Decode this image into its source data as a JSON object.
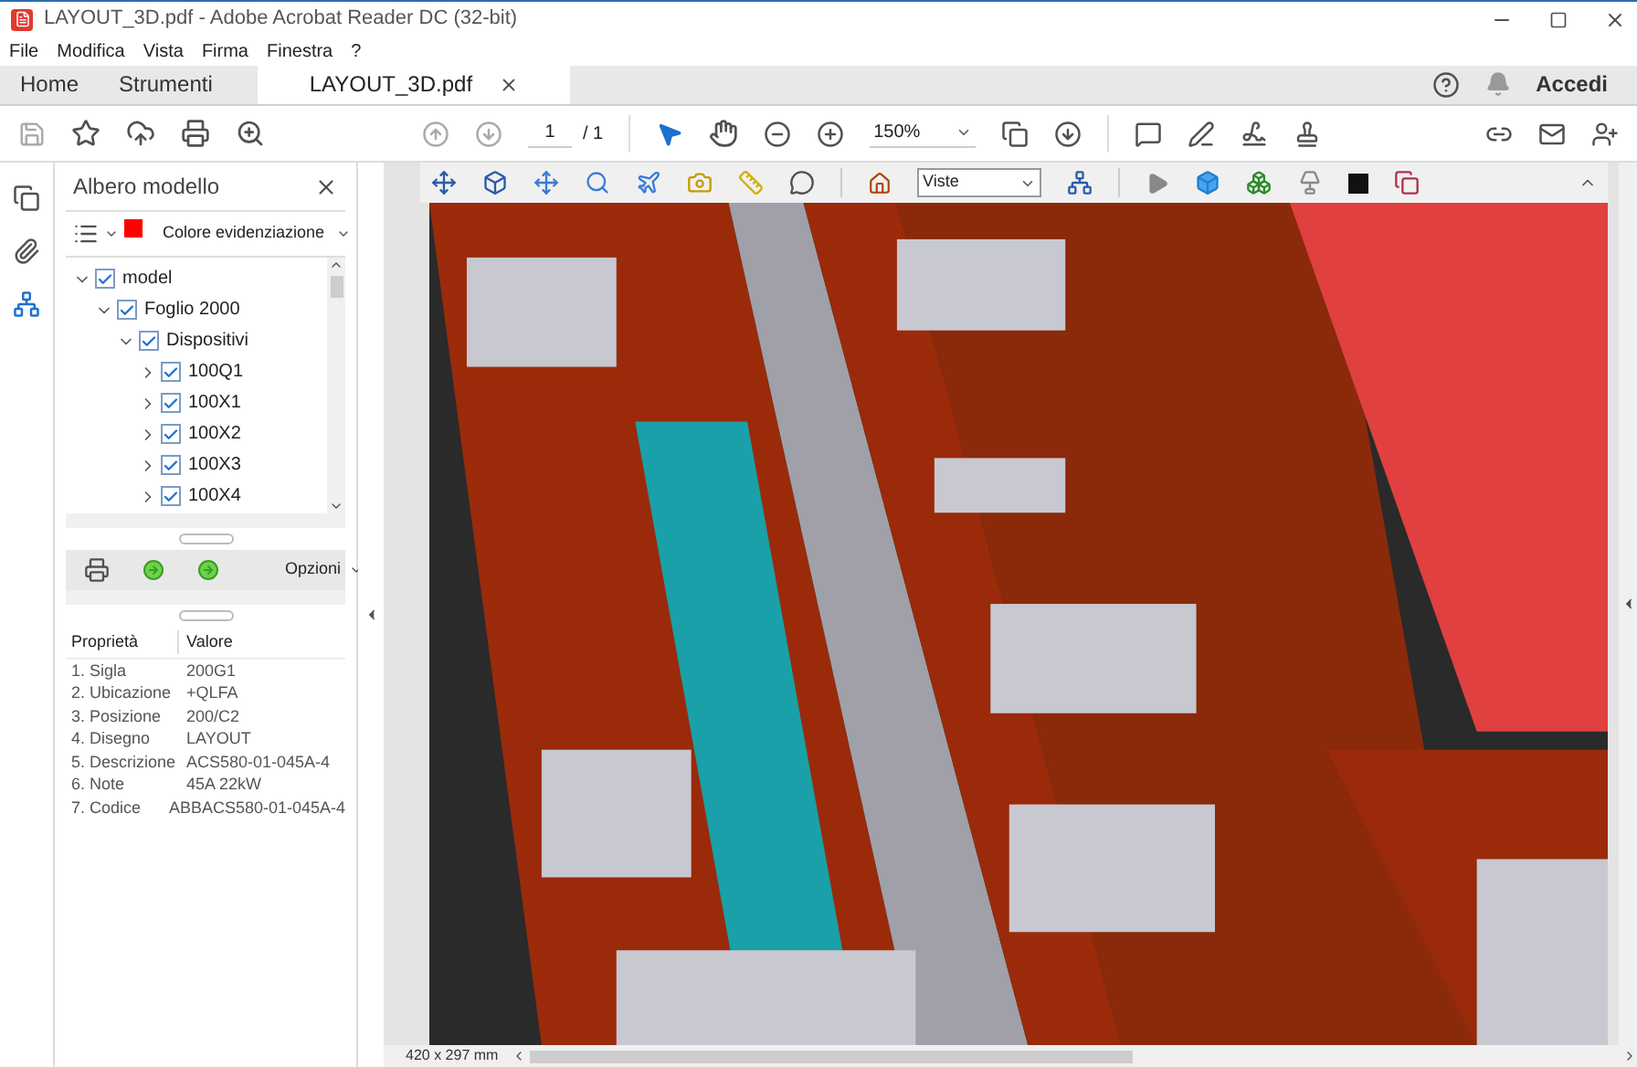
{
  "window": {
    "title": "LAYOUT_3D.pdf - Adobe Acrobat Reader DC (32-bit)"
  },
  "menu": [
    "File",
    "Modifica",
    "Vista",
    "Firma",
    "Finestra",
    "?"
  ],
  "tabs": [
    {
      "label": "Home",
      "selected": false,
      "kind": "nav"
    },
    {
      "label": "Strumenti",
      "selected": false,
      "kind": "nav"
    },
    {
      "label": "LAYOUT_3D.pdf",
      "selected": true,
      "kind": "document"
    }
  ],
  "sign_in": "Accedi",
  "toolbar": {
    "page": "1",
    "page_total": "/ 1",
    "zoom": "150%"
  },
  "panel": {
    "title": "Albero modello",
    "highlight_label": "Colore evidenziazione",
    "color": "#ff0000",
    "tree": [
      {
        "label": "model",
        "expanded": true,
        "checked": true,
        "children": [
          {
            "label": "Foglio 2000",
            "expanded": true,
            "checked": true,
            "children": [
              {
                "label": "Dispositivi",
                "expanded": true,
                "checked": true,
                "children": [
                  {
                    "label": "100Q1",
                    "expanded": false,
                    "checked": true
                  },
                  {
                    "label": "100X1",
                    "expanded": false,
                    "checked": true
                  },
                  {
                    "label": "100X2",
                    "expanded": false,
                    "checked": true
                  },
                  {
                    "label": "100X3",
                    "expanded": false,
                    "checked": true
                  },
                  {
                    "label": "100X4",
                    "expanded": false,
                    "checked": true
                  }
                ]
              }
            ]
          }
        ]
      }
    ],
    "options": "Opzioni",
    "properties": {
      "columns": [
        "Proprietà",
        "Valore"
      ],
      "rows": [
        [
          "1. Sigla",
          "200G1"
        ],
        [
          "2. Ubicazione",
          "+QLFA"
        ],
        [
          "3. Posizione",
          "200/C2"
        ],
        [
          "4. Disegno",
          "LAYOUT"
        ],
        [
          "5. Descrizione",
          "ACS580-01-045A-4"
        ],
        [
          "6. Note",
          "45A 22kW"
        ],
        [
          "7. Codice",
          "ABBACS580-01-045A-4"
        ]
      ]
    }
  },
  "viewer": {
    "views": "Viste"
  },
  "status_bar": {
    "page_size": "420 x 297 mm"
  }
}
